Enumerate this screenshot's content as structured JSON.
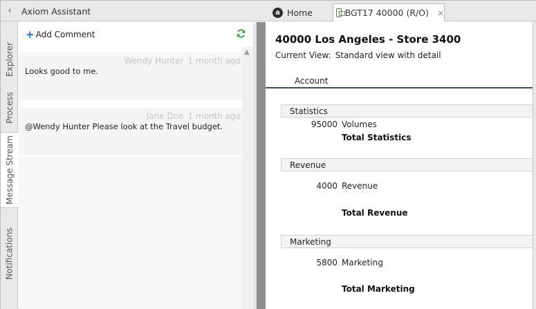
{
  "assistant": {
    "collapse_glyph": "‹",
    "title": "Axiom Assistant"
  },
  "tabs": {
    "home": {
      "label": "Home",
      "icon": "axiom-logo-icon",
      "logo_letter": "a"
    },
    "document": {
      "label": "BGT17 40000 (R/O)",
      "icon": "file-icon",
      "close_glyph": "×"
    }
  },
  "vertical_tabs": [
    {
      "label": "Explorer"
    },
    {
      "label": "Process"
    },
    {
      "label": "Message Stream",
      "active": true
    },
    {
      "label": "Notifications"
    }
  ],
  "stream": {
    "add_comment_label": "Add Comment",
    "add_icon": "plus-icon",
    "refresh_icon": "refresh-icon",
    "messages": [
      {
        "author": "Wendy Hunter",
        "time": "1 month ago",
        "text": "Looks good to me."
      },
      {
        "author": "Jane Doe",
        "time": "1 month ago",
        "text": "@Wendy Hunter Please look at the Travel budget."
      }
    ]
  },
  "document": {
    "title": "40000 Los Angeles - Store 3400",
    "view_label": "Current View:",
    "view_value": "Standard view with detail",
    "column_header": "Account",
    "sections": [
      {
        "name": "Statistics",
        "rows": [
          {
            "amount": "95000",
            "label": "Volumes"
          }
        ],
        "total": "Total Statistics"
      },
      {
        "name": "Revenue",
        "rows": [
          {
            "amount": "4000",
            "label": "Revenue"
          }
        ],
        "total": "Total Revenue"
      },
      {
        "name": "Marketing",
        "rows": [
          {
            "amount": "5800",
            "label": "Marketing"
          }
        ],
        "total": "Total Marketing"
      }
    ]
  },
  "colors": {
    "accent_blue": "#1a6bcc",
    "refresh_green": "#2e9e3a",
    "header_rule": "#3b4e66"
  }
}
